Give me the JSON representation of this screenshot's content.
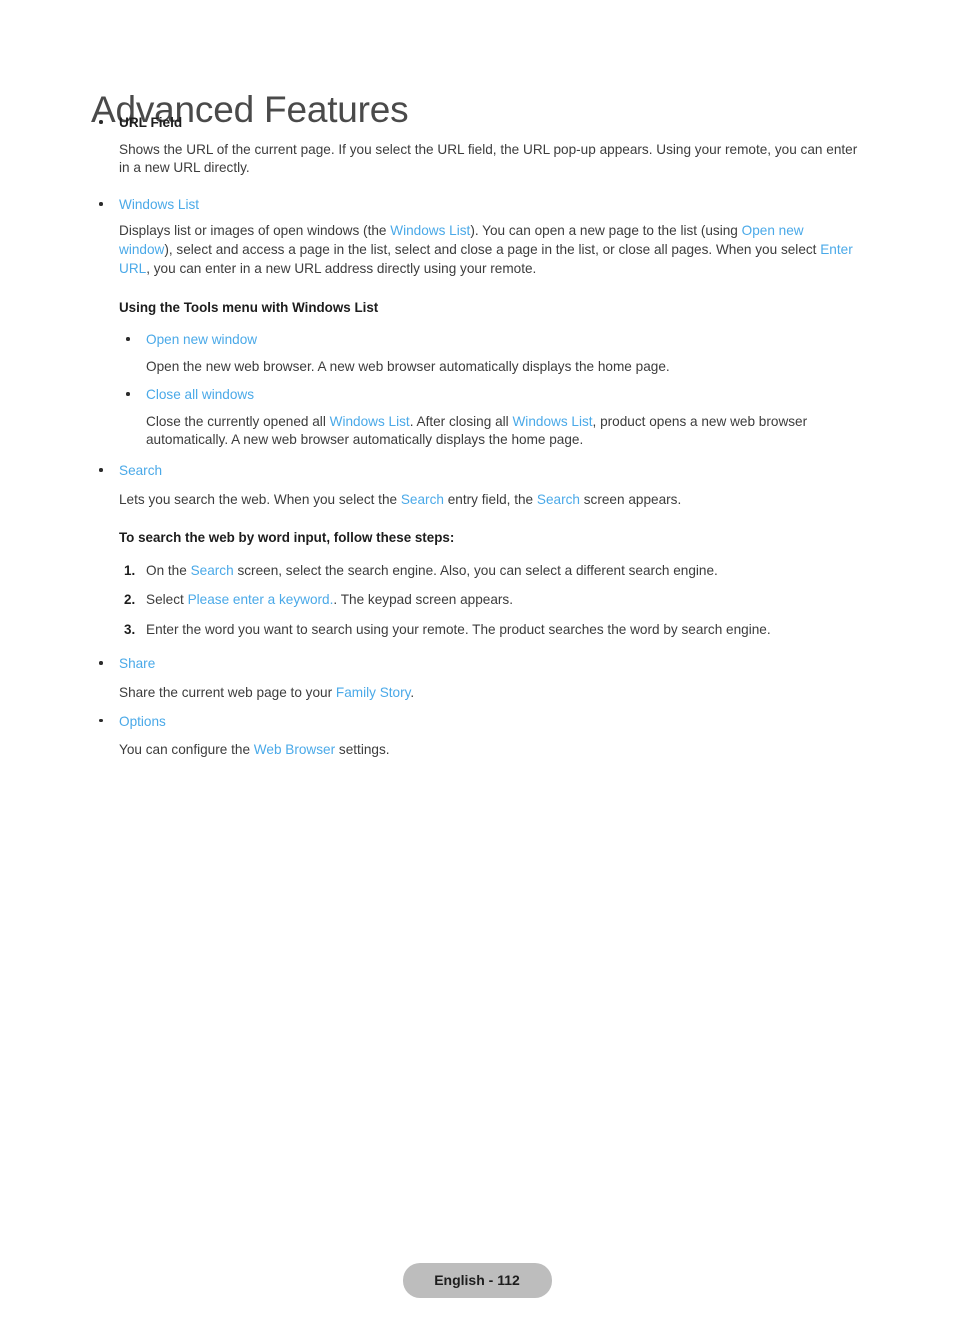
{
  "page": {
    "title": "Advanced Features",
    "footer_label": "English - 112",
    "link_color": "#4aa9e8",
    "body_color": "#3c3c3c",
    "footer_pill_color": "#bdbdbd"
  },
  "sections": {
    "url_field": {
      "bullet_label": "URL Field",
      "body_1": "Shows the URL of the current page. If you select the URL field, the URL pop-up appears. Using your remote, you can enter in a new URL directly."
    },
    "windows_list": {
      "bullet_label": "Windows List",
      "body_a": "Displays list or images of open windows (the ",
      "ref_1": "Windows List",
      "body_b": "). You can open a new page to the list (using ",
      "ref_2": "Open new window",
      "body_c": "), select and access a page in the list, select and close a page in the list, or close all pages. When you select ",
      "ref_3": "Enter URL",
      "body_d": ", you can enter in a new URL address directly using your remote.",
      "subheading": "Using the Tools menu with Windows List",
      "sub_items": [
        {
          "label": "Open new window",
          "body": "Open the new web browser. A new web browser automatically displays the home page."
        },
        {
          "label": "Close all windows",
          "body_a": "Close the currently opened all ",
          "ref_1": "Windows List",
          "body_b": ". After closing all ",
          "ref_2": "Windows List",
          "body_c": ", product opens a new web browser automatically. A new web browser automatically displays the home page."
        }
      ]
    },
    "search": {
      "bullet_label": "Search",
      "body_a": "Lets you search the web. When you select the ",
      "ref_1": "Search",
      "body_b": " entry field, the ",
      "ref_2": "Search",
      "body_c": " screen appears.",
      "subheading": "To search the web by word input, follow these steps:",
      "steps": [
        {
          "num": "1.",
          "body_a": "On the ",
          "ref": "Search",
          "body_b": " screen, select the search engine. Also, you can select a different search engine."
        },
        {
          "num": "2.",
          "body_a": "Select ",
          "ref": "Please enter a keyword.",
          "body_b": ". The keypad screen appears."
        },
        {
          "num": "3.",
          "body_a": "Enter the word you want to search using your remote. The product searches the word by search engine.",
          "ref": "",
          "body_b": ""
        }
      ]
    },
    "share": {
      "bullet_label": "Share",
      "body_a": "Share the current web page to your ",
      "ref_1": "Family Story",
      "body_b": "."
    },
    "options": {
      "bullet_label": "Options",
      "body_a": "You can configure the ",
      "ref_1": "Web Browser",
      "body_b": " settings."
    }
  }
}
